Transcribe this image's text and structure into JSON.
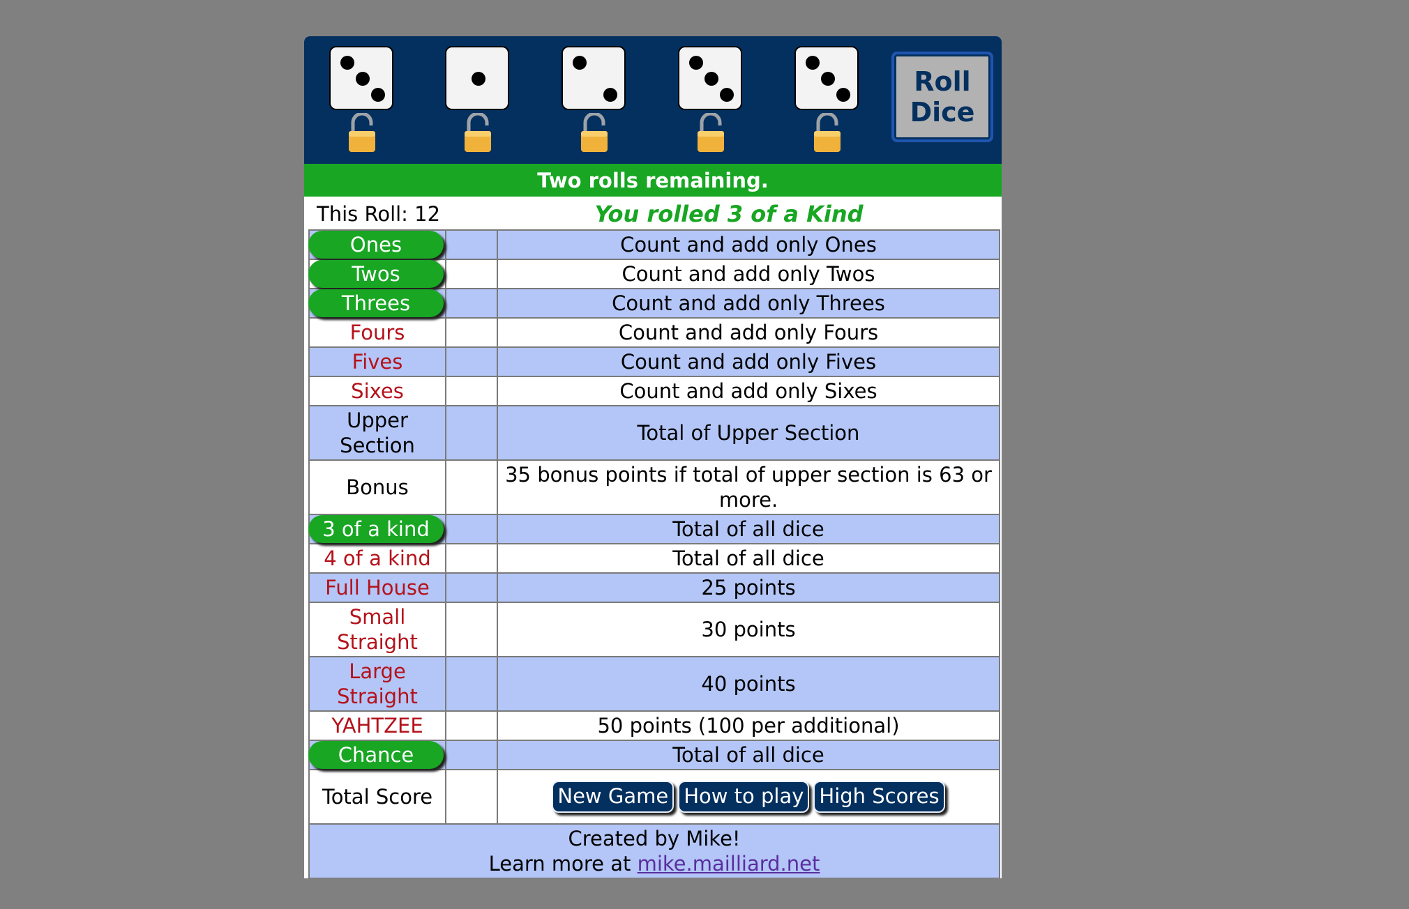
{
  "dice": [
    {
      "value": 3,
      "locked": false
    },
    {
      "value": 1,
      "locked": false
    },
    {
      "value": 2,
      "locked": false
    },
    {
      "value": 3,
      "locked": false
    },
    {
      "value": 3,
      "locked": false
    }
  ],
  "roll_button": {
    "label": "Roll\nDice"
  },
  "status": {
    "message": "Two rolls remaining."
  },
  "this_roll": {
    "label": "This Roll: 12"
  },
  "roll_result": {
    "message": "You rolled 3 of a Kind"
  },
  "rows": [
    {
      "name": "Ones",
      "score": "",
      "description": "Count and add only Ones"
    },
    {
      "name": "Twos",
      "score": "",
      "description": "Count and add only Twos"
    },
    {
      "name": "Threes",
      "score": "",
      "description": "Count and add only Threes"
    },
    {
      "name": "Fours",
      "score": "",
      "description": "Count and add only Fours"
    },
    {
      "name": "Fives",
      "score": "",
      "description": "Count and add only Fives"
    },
    {
      "name": "Sixes",
      "score": "",
      "description": "Count and add only Sixes"
    },
    {
      "name": "Upper Section",
      "score": "",
      "description": "Total of Upper Section"
    },
    {
      "name": "Bonus",
      "score": "",
      "description": "35 bonus points if total of upper section is 63 or more."
    },
    {
      "name": "3 of a kind",
      "score": "",
      "description": "Total of all dice"
    },
    {
      "name": "4 of a kind",
      "score": "",
      "description": "Total of all dice"
    },
    {
      "name": "Full House",
      "score": "",
      "description": "25 points"
    },
    {
      "name": "Small Straight",
      "score": "",
      "description": "30 points"
    },
    {
      "name": "Large Straight",
      "score": "",
      "description": "40 points"
    },
    {
      "name": "YAHTZEE",
      "score": "",
      "description": "50 points (100 per additional)"
    },
    {
      "name": "Chance",
      "score": "",
      "description": "Total of all dice"
    },
    {
      "name": "Total Score",
      "score": ""
    }
  ],
  "buttons": {
    "new_game": "New Game",
    "how_to_play": "How to play",
    "high_scores": "High Scores"
  },
  "footer": {
    "line1": "Created by Mike!",
    "line2_prefix": "Learn more at ",
    "link_text": "mike.mailliard.net"
  },
  "colors": {
    "header_bg": "#04305f",
    "status_bg": "#18a623",
    "available_category": "#18a623",
    "unavailable_category": "#b5121b",
    "row_blue": "#b3c6f7"
  },
  "icons": {
    "lock": "unlocked-padlock-icon"
  }
}
